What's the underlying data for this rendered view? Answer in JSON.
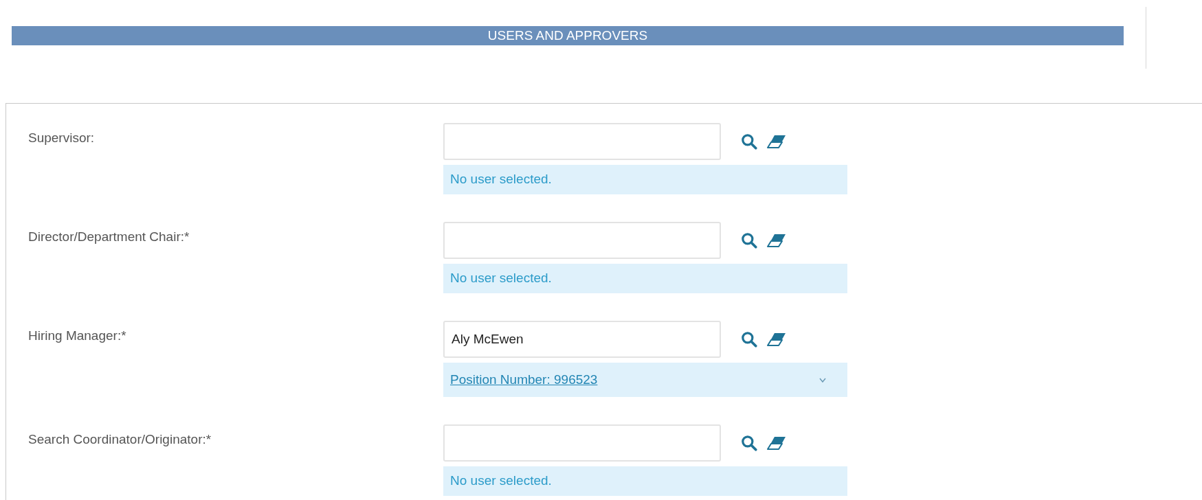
{
  "section_title": "USERS AND APPROVERS",
  "rows": [
    {
      "label": "Supervisor:",
      "value": "",
      "selection": {
        "kind": "message",
        "text": "No user selected."
      }
    },
    {
      "label": "Director/Department Chair:*",
      "value": "",
      "selection": {
        "kind": "message",
        "text": "No user selected."
      }
    },
    {
      "label": "Hiring Manager:*",
      "value": "Aly McEwen",
      "selection": {
        "kind": "link",
        "text": "Position Number: 996523",
        "expanded": false
      }
    },
    {
      "label": "Search Coordinator/Originator:*",
      "value": "",
      "selection": {
        "kind": "message",
        "text": "No user selected."
      }
    }
  ]
}
